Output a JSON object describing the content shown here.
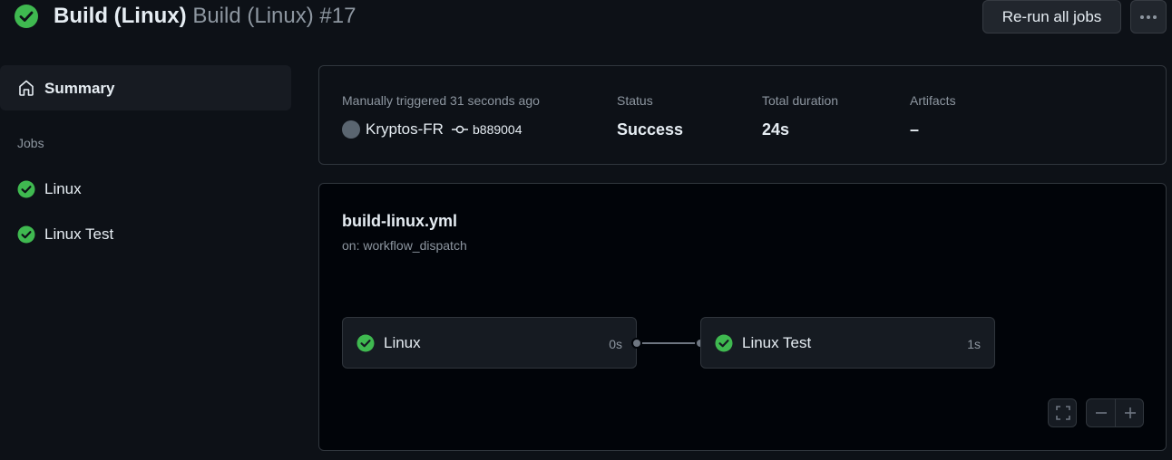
{
  "header": {
    "workflow_name": "Build (Linux)",
    "run_name": "Build (Linux) #17",
    "rerun_label": "Re-run all jobs",
    "status_icon": "check-circle-fill-icon",
    "more_icon": "kebab-horizontal-icon"
  },
  "sidebar": {
    "summary_label": "Summary",
    "summary_icon": "home-icon",
    "jobs_heading": "Jobs",
    "jobs": [
      {
        "label": "Linux",
        "status": "success"
      },
      {
        "label": "Linux Test",
        "status": "success"
      }
    ]
  },
  "summary": {
    "trigger_label": "Manually triggered 31 seconds ago",
    "actor": "Kryptos-FR",
    "commit": "b889004",
    "status_label": "Status",
    "status_value": "Success",
    "duration_label": "Total duration",
    "duration_value": "24s",
    "artifacts_label": "Artifacts",
    "artifacts_value": "–"
  },
  "graph": {
    "file": "build-linux.yml",
    "trigger": "on: workflow_dispatch",
    "jobs": [
      {
        "name": "Linux",
        "duration": "0s"
      },
      {
        "name": "Linux Test",
        "duration": "1s"
      }
    ],
    "controls": [
      "fullscreen-icon",
      "zoom-out-icon",
      "zoom-in-icon"
    ]
  },
  "colors": {
    "success": "#3fb950",
    "background": "#0d1117",
    "canvas": "#010409",
    "border": "#30363d",
    "muted_text": "#8d96a0"
  }
}
